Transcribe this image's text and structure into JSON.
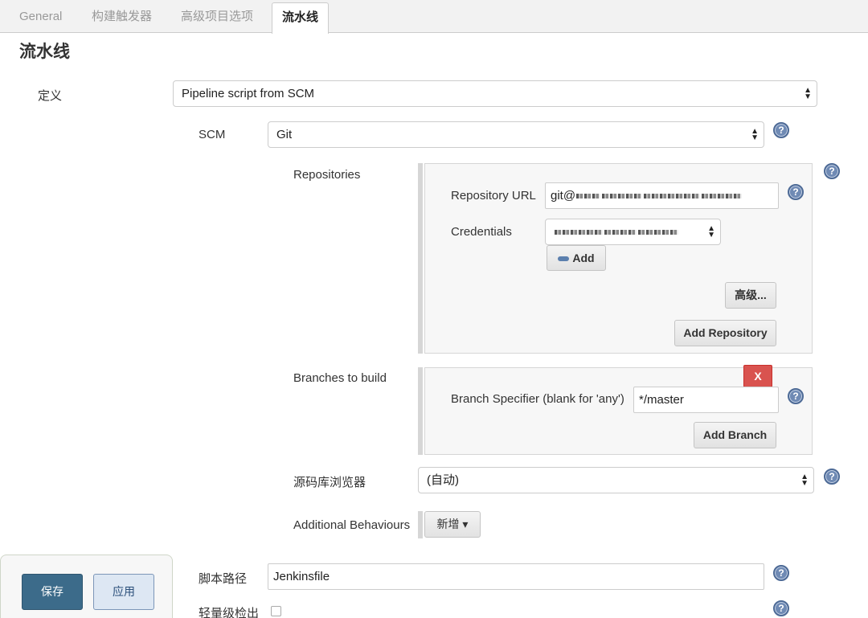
{
  "tabs": [
    "General",
    "构建触发器",
    "高级项目选项",
    "流水线"
  ],
  "section_title": "流水线",
  "definition": {
    "label": "定义",
    "value": "Pipeline script from SCM"
  },
  "scm": {
    "label": "SCM",
    "value": "Git"
  },
  "repositories": {
    "label": "Repositories",
    "url_label": "Repository URL",
    "url_value_prefix": "git@",
    "credentials_label": "Credentials",
    "add_button": "Add",
    "advanced_button": "高级...",
    "add_repository_button": "Add Repository"
  },
  "branches": {
    "label": "Branches to build",
    "remove_button": "X",
    "specifier_label": "Branch Specifier (blank for 'any')",
    "specifier_value": "*/master",
    "add_branch_button": "Add Branch"
  },
  "repo_browser": {
    "label": "源码库浏览器",
    "value": "(自动)"
  },
  "additional_behaviours": {
    "label": "Additional Behaviours",
    "button": "新增"
  },
  "script_path": {
    "label": "脚本路径",
    "value": "Jenkinsfile"
  },
  "lightweight_checkout": {
    "label": "轻量级检出",
    "checked": false
  },
  "footer": {
    "save": "保存",
    "apply": "应用"
  },
  "help_icon_text": "?",
  "select_arrow_up": "▲",
  "select_arrow_down": "▼",
  "caret_down": "▾",
  "colors": {
    "primary": "#3c6b8a",
    "danger": "#d9534f",
    "help": "#6f8ab4"
  }
}
